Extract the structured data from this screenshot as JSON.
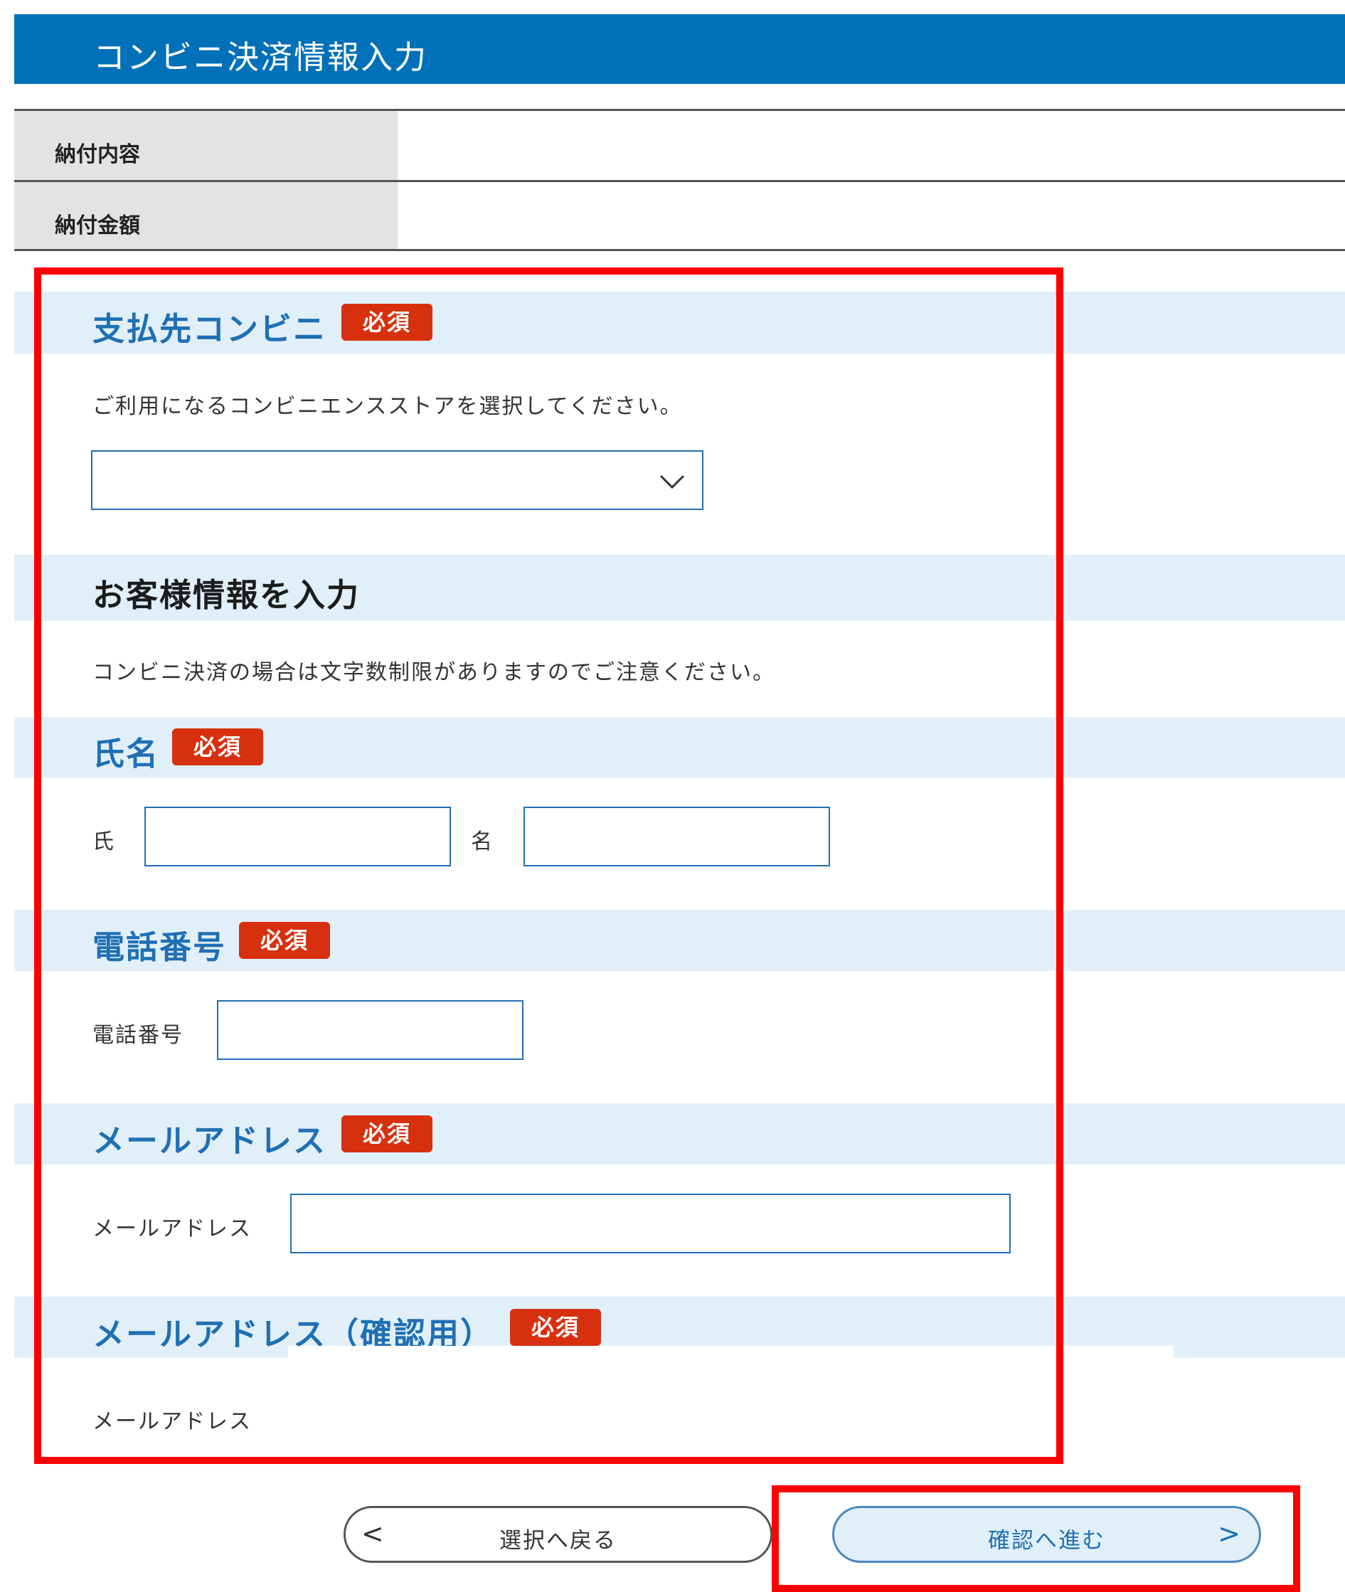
{
  "header": {
    "title": "コンビニ決済情報入力"
  },
  "summary": {
    "rows": [
      {
        "label": "納付内容",
        "value": ""
      },
      {
        "label": "納付金額",
        "value": ""
      }
    ]
  },
  "store": {
    "title": "支払先コンビニ",
    "required": "必須",
    "help": "ご利用になるコンビニエンスストアを選択してください。",
    "selected": ""
  },
  "customer": {
    "title": "お客様情報を入力",
    "note": "コンビニ決済の場合は文字数制限がありますのでご注意ください。"
  },
  "name": {
    "title": "氏名",
    "required": "必須",
    "last_label": "氏",
    "first_label": "名",
    "last_value": "",
    "first_value": ""
  },
  "phone": {
    "title": "電話番号",
    "required": "必須",
    "label": "電話番号",
    "value": ""
  },
  "email": {
    "title": "メールアドレス",
    "required": "必須",
    "label": "メールアドレス",
    "value": ""
  },
  "email_confirm": {
    "title": "メールアドレス（確認用）",
    "required": "必須",
    "label": "メールアドレス"
  },
  "buttons": {
    "back": {
      "label": "選択へ戻る",
      "arrow": "<"
    },
    "next": {
      "label": "確認へ進む",
      "arrow": ">"
    }
  },
  "colors": {
    "header_bg": "#0070b9",
    "section_band": "#e1eff9",
    "section_title": "#1f6fb4",
    "required_badge": "#d7300f",
    "highlight_border": "#ff0000"
  },
  "icons": {
    "select_arrow": "chevron-down-icon",
    "back_arrow": "chevron-left-icon",
    "next_arrow": "chevron-right-icon"
  }
}
